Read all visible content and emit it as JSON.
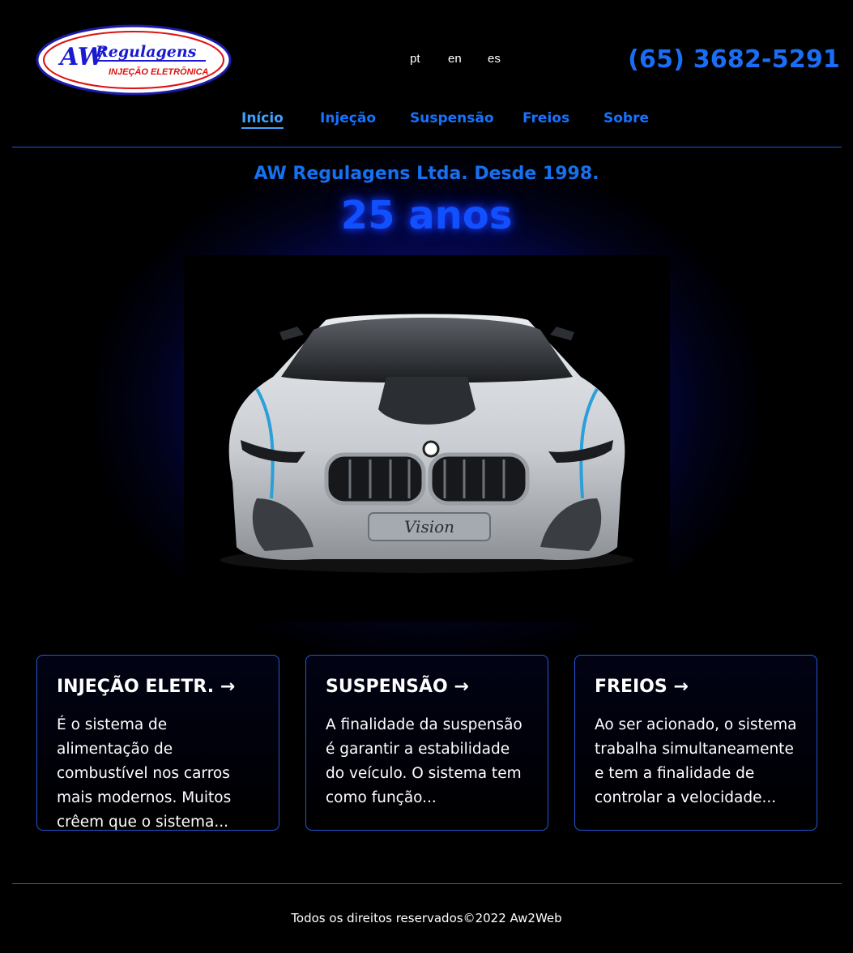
{
  "header": {
    "logo": {
      "line1": "AW",
      "line2": "Regulagens",
      "line3": "INJEÇÃO ELETRÔNICA"
    },
    "languages": [
      "pt",
      "en",
      "es"
    ],
    "phone": "(65) 3682-5291"
  },
  "nav": {
    "items": [
      {
        "label": "Início",
        "active": true
      },
      {
        "label": "Injeção",
        "active": false
      },
      {
        "label": "Suspensão",
        "active": false
      },
      {
        "label": "Freios",
        "active": false
      },
      {
        "label": "Sobre",
        "active": false
      }
    ]
  },
  "hero": {
    "tagline": "AW Regulagens Ltda. Desde 1998.",
    "years": "25 anos",
    "image_subject": "white concept sports car front view",
    "plate_text": "Vision"
  },
  "cards": [
    {
      "title": "INJEÇÃO ELETR. →",
      "text": "É o sistema de alimentação de combustível nos carros mais modernos. Muitos crêem que o sistema..."
    },
    {
      "title": "SUSPENSÃO →",
      "text": "A finalidade da suspensão é garantir a estabilidade do veículo. O sistema tem como função..."
    },
    {
      "title": "FREIOS →",
      "text": "Ao ser acionado, o sistema trabalha simultaneamente e tem a finalidade de controlar a velocidade..."
    }
  ],
  "footer": {
    "text": "Todos os direitos reservados©2022 Aw2Web"
  },
  "colors": {
    "accent": "#1673ff",
    "active_nav": "#3fa1ff",
    "glow": "#0a26d8",
    "border": "#2358d8",
    "background": "#000000"
  }
}
